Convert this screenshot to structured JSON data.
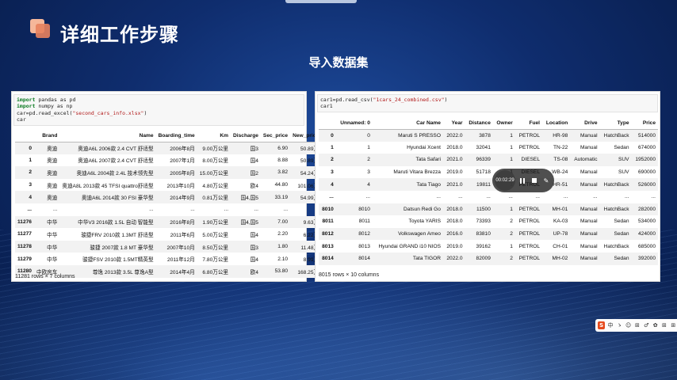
{
  "header": {
    "title": "详细工作步骤",
    "section_title": "导入数据集"
  },
  "left_notebook": {
    "code": [
      {
        "kw": "import",
        "rest": " pandas as pd"
      },
      {
        "kw": "import",
        "rest": " numpy as np"
      },
      {
        "kw": "",
        "rest": "car=pd.read_excel(",
        "str": "\"second_cars_info.xlsx\"",
        "tail": ")"
      },
      {
        "kw": "",
        "rest": "car"
      }
    ],
    "columns": [
      "",
      "Brand",
      "Name",
      "Boarding_time",
      "Km",
      "Discharge",
      "Sec_price",
      "New_price"
    ],
    "rows": [
      [
        "0",
        "奥迪",
        "奥迪A6L 2006款 2.4 CVT 舒适型",
        "2006年8月",
        "9.00万公里",
        "国3",
        "6.90",
        "50.89万"
      ],
      [
        "1",
        "奥迪",
        "奥迪A6L 2007款 2.4 CVT 舒适型",
        "2007年1月",
        "8.00万公里",
        "国4",
        "8.88",
        "50.89万"
      ],
      [
        "2",
        "奥迪",
        "奥迪A6L 2004款 2.4L 技术领先型",
        "2005年8月",
        "15.00万公里",
        "国2",
        "3.82",
        "54.24万"
      ],
      [
        "3",
        "奥迪",
        "奥迪A8L 2013款 45 TFSI quattro舒适型",
        "2013年10月",
        "4.80万公里",
        "欧4",
        "44.80",
        "101.06万"
      ],
      [
        "4",
        "奥迪",
        "奥迪A6L 2014款 30 FSI 豪华型",
        "2014年9月",
        "0.81万公里",
        "国4,国5",
        "33.19",
        "54.99万"
      ],
      [
        "...",
        "...",
        "...",
        "...",
        "...",
        "...",
        "...",
        "..."
      ],
      [
        "11276",
        "中华",
        "中华V3 2016款 1.5L 自动 智能型",
        "2016年8月",
        "1.90万公里",
        "国4,国5",
        "7.00",
        "9.63万"
      ],
      [
        "11277",
        "中华",
        "骏捷FRV 2010款 1.3MT 舒适型",
        "2011年6月",
        "5.00万公里",
        "国4",
        "2.20",
        "6.22万"
      ],
      [
        "11278",
        "中华",
        "骏捷 2007款 1.8 MT 豪华型",
        "2007年10月",
        "8.50万公里",
        "国3",
        "1.80",
        "11.48万"
      ],
      [
        "11279",
        "中华",
        "骏捷FSV 2010款 1.5MT精英型",
        "2011年12月",
        "7.80万公里",
        "国4",
        "2.10",
        "8.99万"
      ],
      [
        "11280",
        "中欧房车",
        "尊逸 2013款 3.5L 尊逸A型",
        "2014年4月",
        "6.80万公里",
        "欧4",
        "53.80",
        "168.25万"
      ]
    ],
    "shape": "11281 rows × 7 columns"
  },
  "right_notebook": {
    "code": [
      {
        "kw": "",
        "rest": "car1=pd.read_csv(",
        "str": "\"1cars_24_combined.csv\"",
        "tail": ")"
      },
      {
        "kw": "",
        "rest": "car1"
      }
    ],
    "columns": [
      "",
      "Unnamed: 0",
      "Car Name",
      "Year",
      "Distance",
      "Owner",
      "Fuel",
      "Location",
      "Drive",
      "Type",
      "Price"
    ],
    "rows": [
      [
        "0",
        "0",
        "Maruti S PRESSO",
        "2022.0",
        "3878",
        "1",
        "PETROL",
        "HR-98",
        "Manual",
        "HatchBack",
        "514000"
      ],
      [
        "1",
        "1",
        "Hyundai Xcent",
        "2018.0",
        "32041",
        "1",
        "PETROL",
        "TN-22",
        "Manual",
        "Sedan",
        "674000"
      ],
      [
        "2",
        "2",
        "Tata Safari",
        "2021.0",
        "96339",
        "1",
        "DIESEL",
        "TS-08",
        "Automatic",
        "SUV",
        "1952000"
      ],
      [
        "3",
        "3",
        "Maruti Vitara Brezza",
        "2019.0",
        "51718",
        "1",
        "DIESEL",
        "WB-24",
        "Manual",
        "SUV",
        "690000"
      ],
      [
        "4",
        "4",
        "Tata Tiago",
        "2021.0",
        "19811",
        "1",
        "PETROL",
        "HR-51",
        "Manual",
        "HatchBack",
        "526000"
      ],
      [
        "...",
        "...",
        "...",
        "...",
        "...",
        "...",
        "...",
        "...",
        "...",
        "...",
        "..."
      ],
      [
        "8010",
        "8010",
        "Datsun Redi Go",
        "2018.0",
        "11500",
        "1",
        "PETROL",
        "MH-01",
        "Manual",
        "HatchBack",
        "282000"
      ],
      [
        "8011",
        "8011",
        "Toyota YARIS",
        "2018.0",
        "73393",
        "2",
        "PETROL",
        "KA-03",
        "Manual",
        "Sedan",
        "534000"
      ],
      [
        "8012",
        "8012",
        "Volkswagen Ameo",
        "2016.0",
        "83810",
        "2",
        "PETROL",
        "UP-78",
        "Manual",
        "Sedan",
        "424000"
      ],
      [
        "8013",
        "8013",
        "Hyundai GRAND i10 NIOS",
        "2019.0",
        "39162",
        "1",
        "PETROL",
        "CH-01",
        "Manual",
        "HatchBack",
        "685000"
      ],
      [
        "8014",
        "8014",
        "Tata TIGOR",
        "2022.0",
        "82009",
        "2",
        "PETROL",
        "MH-02",
        "Manual",
        "Sedan",
        "392000"
      ]
    ],
    "shape": "8015 rows × 10 columns"
  },
  "player": {
    "time": "00:02:29"
  },
  "toolbar": {
    "logo": "S",
    "items": [
      "中",
      "ゝ",
      "☺",
      "⊞",
      "♂",
      "✿",
      "⊞",
      "⊞"
    ]
  }
}
